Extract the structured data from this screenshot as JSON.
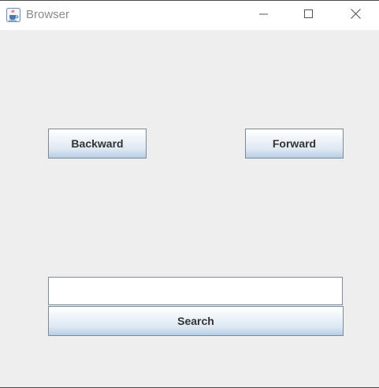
{
  "window": {
    "title": "Browser",
    "app_icon": "java-cup-icon",
    "controls": {
      "minimize_icon": "minimize-icon",
      "maximize_icon": "maximize-icon",
      "close_icon": "close-icon"
    }
  },
  "navigation": {
    "backward_label": "Backward",
    "forward_label": "Forward"
  },
  "search": {
    "value": "",
    "placeholder": "",
    "button_label": "Search"
  },
  "colors": {
    "background": "#eeeeee",
    "title_text": "#8a8a8a",
    "button_text": "#333333",
    "button_border": "#7a8a99"
  }
}
